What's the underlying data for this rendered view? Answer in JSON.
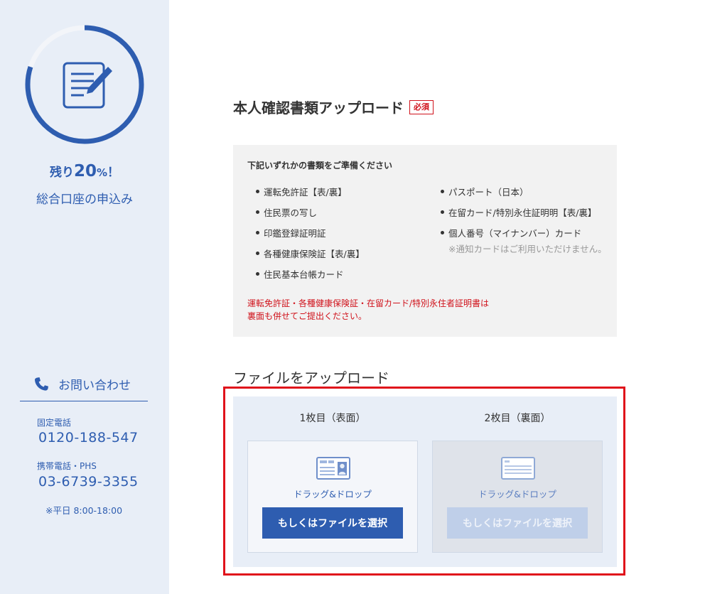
{
  "sidebar": {
    "progress_percent": 80,
    "remain_prefix": "残り",
    "remain_value": "20",
    "remain_unit": "%",
    "remain_suffix": "！",
    "subtitle": "総合口座の申込み",
    "contact": {
      "title": "お問い合わせ",
      "landline_label": "固定電話",
      "landline_number": "0120-188-547",
      "mobile_label": "携帯電話・PHS",
      "mobile_number": "03-6739-3355",
      "hours": "※平日 8:00-18:00"
    }
  },
  "main": {
    "title": "本人確認書類アップロード",
    "required_badge": "必須",
    "info": {
      "heading": "下記いずれかの書類をご準備ください",
      "left_items": [
        "運転免許証【表/裏】",
        "住民票の写し",
        "印鑑登録証明証",
        "各種健康保険証【表/裏】",
        "住民基本台帳カード"
      ],
      "right_items": [
        "パスポート（日本）",
        "在留カード/特別永住証明明【表/裏】",
        "個人番号（マイナンバー）カード"
      ],
      "right_note": "※通知カードはご利用いただけません。",
      "warning_line1": "運転免許証・各種健康保険証・在留カード/特別永住者証明書は",
      "warning_line2": "裏面も併せてご提出ください。"
    },
    "upload": {
      "title": "ファイルをアップロード",
      "front_label": "1枚目（表面）",
      "back_label": "2枚目（裏面）",
      "drop_text": "ドラッグ&ドロップ",
      "select_button": "もしくはファイルを選択"
    }
  },
  "colors": {
    "brand_blue": "#2e5db0",
    "sidebar_bg": "#e8eef7",
    "required_red": "#d0121b",
    "highlight_red": "#e0121b"
  }
}
